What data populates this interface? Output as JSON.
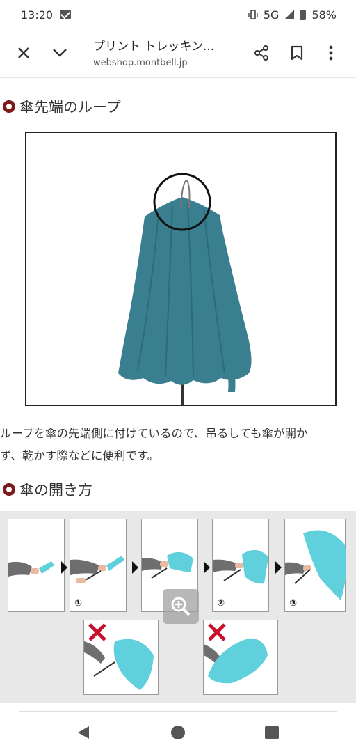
{
  "status_bar": {
    "time": "13:20",
    "network": "5G",
    "battery": "58%"
  },
  "toolbar": {
    "title": "プリント トレッキン...",
    "url": "webshop.montbell.jp"
  },
  "section1": {
    "title": "傘先端のループ"
  },
  "body": {
    "line1": "ループを傘の先端側に付けているので、吊るしても傘が開か",
    "line2": "ず、乾かす際などに便利です。"
  },
  "section2": {
    "title": "傘の開き方"
  },
  "steps": [
    {
      "label": ""
    },
    {
      "label": "①"
    },
    {
      "label": ""
    },
    {
      "label": "②"
    },
    {
      "label": "③"
    }
  ],
  "colors": {
    "bullet": "#7a1a1a",
    "umbrella_dark": "#3a7f8f",
    "umbrella_light": "#5fd0dc",
    "wrong_mark": "#c8102e"
  }
}
